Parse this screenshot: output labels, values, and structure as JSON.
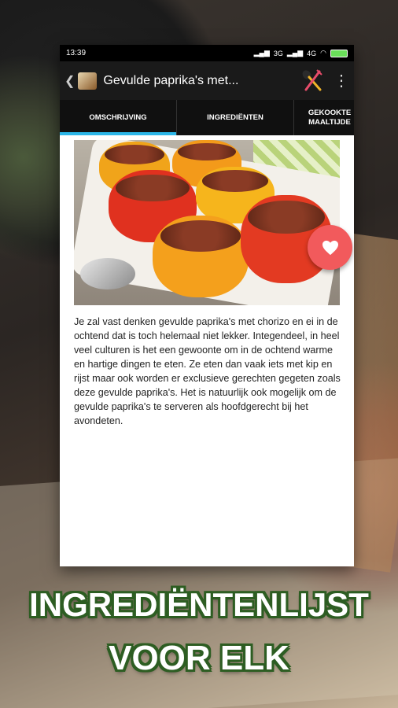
{
  "status_bar": {
    "time": "13:39",
    "network_1": "3G",
    "network_2": "4G",
    "battery_color": "#6adf5a"
  },
  "app_bar": {
    "title": "Gevulde paprika's met..."
  },
  "tabs": [
    {
      "label": "OMSCHRIJVING",
      "active": true
    },
    {
      "label": "INGREDIËNTEN",
      "active": false
    },
    {
      "label": "GEKOOKTE MAALTIJDE",
      "active": false
    }
  ],
  "description": "Je zal vast denken gevulde paprika's met chorizo en ei in de ochtend dat is toch helemaal niet lekker. Integendeel, in heel veel culturen is het een gewoonte om in de ochtend warme en hartige dingen te eten. Ze eten dan vaak iets met kip en rijst maar ook worden er exclusieve gerechten gegeten zoals deze gevulde paprika's. Het is natuurlijk ook mogelijk om de gevulde paprika's te serveren als hoofdgerecht bij het avondeten.",
  "promo": {
    "line1": "INGREDIËNTENLIJST",
    "line2": "VOOR ELK"
  },
  "colors": {
    "accent": "#2bb6e8",
    "fab": "#f25a5c",
    "promo_outline": "#2d5d22"
  },
  "icons": {
    "back": "chevron-left-icon",
    "menu": "more-vert-icon",
    "favorite": "heart-icon",
    "utensils": "spoon-fork-icon"
  }
}
